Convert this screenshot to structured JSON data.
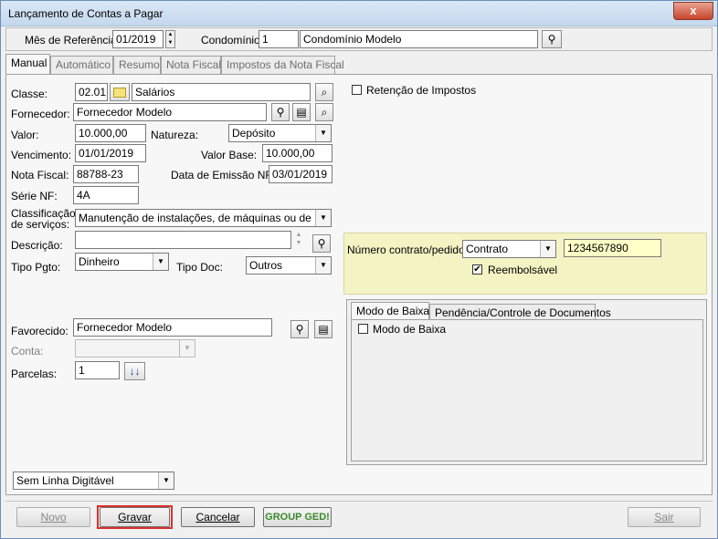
{
  "window": {
    "title": "Lançamento de Contas a Pagar",
    "close_glyph": "x"
  },
  "header": {
    "mes_label": "Mês de Referência:",
    "mes_value": "01/2019",
    "condominio_label": "Condomínio:",
    "condominio_code": "1",
    "condominio_name": "Condomínio Modelo"
  },
  "tabs": [
    "Manual",
    "Automático",
    "Resumo",
    "Nota Fiscal",
    "Impostos da Nota Fiscal"
  ],
  "form": {
    "classe_label": "Classe:",
    "classe_code": "02.01",
    "classe_name": "Salários",
    "fornecedor_label": "Fornecedor:",
    "fornecedor_value": "Fornecedor Modelo",
    "valor_label": "Valor:",
    "valor_value": "10.000,00",
    "natureza_label": "Natureza:",
    "natureza_value": "Depósito",
    "vencimento_label": "Vencimento:",
    "vencimento_value": "01/01/2019",
    "valor_base_label": "Valor Base:",
    "valor_base_value": "10.000,00",
    "nota_fiscal_label": "Nota Fiscal:",
    "nota_fiscal_value": "88788-23",
    "data_emissao_label": "Data de Emissão NF:",
    "data_emissao_value": "03/01/2019",
    "serie_label": "Série NF:",
    "serie_value": "4A",
    "classificacao_label_1": "Classificação",
    "classificacao_label_2": "de serviços:",
    "classificacao_value": "Manutenção de instalações, de máquinas ou de equipa",
    "descricao_label": "Descrição:",
    "descricao_value": "",
    "tipo_pgto_label": "Tipo Pgto:",
    "tipo_pgto_value": "Dinheiro",
    "tipo_doc_label": "Tipo Doc:",
    "tipo_doc_value": "Outros",
    "favorecido_label": "Favorecido:",
    "favorecido_value": "Fornecedor Modelo",
    "conta_label": "Conta:",
    "conta_value": "",
    "parcelas_label": "Parcelas:",
    "parcelas_value": "1",
    "linha_digitavel_value": "Sem Linha Digitável"
  },
  "retencao": {
    "label": "Retenção de Impostos",
    "checked": false
  },
  "contrato": {
    "label": "Número contrato/pedido:",
    "tipo_value": "Contrato",
    "numero_value": "1234567890",
    "reembolsavel_label": "Reembolsável",
    "reembolsavel_checked": true,
    "panel_color": "#f4f3c4"
  },
  "subtabs": [
    "Modo de Baixa",
    "Pendência/Controle de Documentos"
  ],
  "modo_baixa": {
    "label": "Modo de Baixa",
    "checked": false
  },
  "footer": {
    "novo": "Novo",
    "gravar": "Gravar",
    "cancelar": "Cancelar",
    "group_ged": "GROUP GED!",
    "sair": "Sair",
    "highlight_color": "#d9302c"
  },
  "icons": {
    "spin": "spin-updown-icon",
    "binoculars": "binoculars-icon",
    "folder": "folder-icon",
    "search": "magnifier-icon",
    "properties": "properties-icon",
    "arrows": "down-arrows-icon"
  }
}
